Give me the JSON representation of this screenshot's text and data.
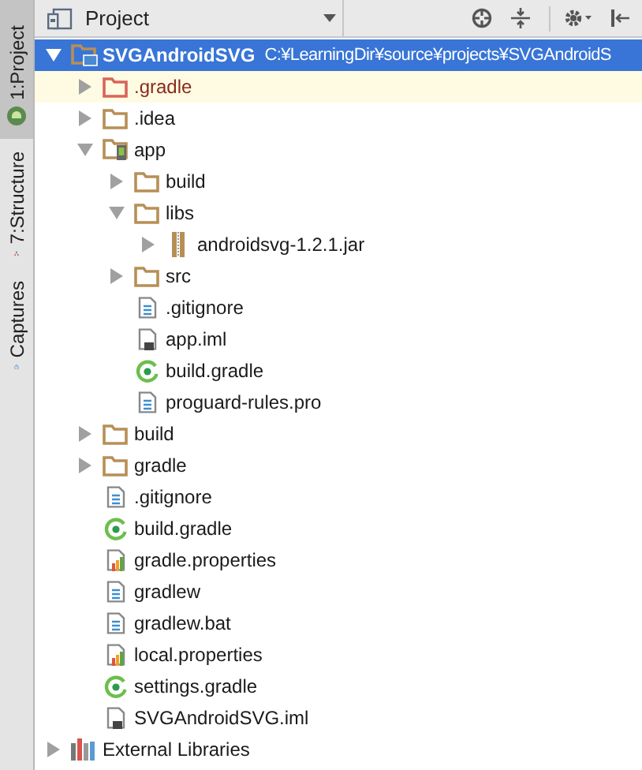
{
  "side_tabs": [
    {
      "label": "1:Project",
      "selected": true
    },
    {
      "label": "7:Structure",
      "selected": false
    },
    {
      "label": "Captures",
      "selected": false
    }
  ],
  "header": {
    "view": "Project"
  },
  "tree": [
    {
      "name": "SVGAndroidSVG",
      "path": "C:¥LearningDir¥source¥projects¥SVGAndroidS",
      "kind": "project",
      "expanded": true,
      "selected": true,
      "highlighted": false,
      "children": [
        {
          "name": ".gradle",
          "kind": "excluded",
          "expanded": false,
          "selected": false,
          "highlighted": true
        },
        {
          "name": ".idea",
          "kind": "folder",
          "expanded": false,
          "selected": false,
          "highlighted": false
        },
        {
          "name": "app",
          "kind": "module",
          "expanded": true,
          "selected": false,
          "highlighted": false,
          "children": [
            {
              "name": "build",
              "kind": "folder",
              "expanded": false,
              "selected": false,
              "highlighted": false
            },
            {
              "name": "libs",
              "kind": "folder",
              "expanded": true,
              "selected": false,
              "highlighted": false,
              "children": [
                {
                  "name": "androidsvg-1.2.1.jar",
                  "kind": "jar",
                  "expanded": false,
                  "selected": false,
                  "highlighted": false
                }
              ]
            },
            {
              "name": "src",
              "kind": "folder",
              "expanded": false,
              "selected": false,
              "highlighted": false
            },
            {
              "name": ".gitignore",
              "kind": "text",
              "selected": false,
              "highlighted": false
            },
            {
              "name": "app.iml",
              "kind": "iml",
              "selected": false,
              "highlighted": false
            },
            {
              "name": "build.gradle",
              "kind": "gradle",
              "selected": false,
              "highlighted": false
            },
            {
              "name": "proguard-rules.pro",
              "kind": "text",
              "selected": false,
              "highlighted": false
            }
          ]
        },
        {
          "name": "build",
          "kind": "folder",
          "expanded": false,
          "selected": false,
          "highlighted": false
        },
        {
          "name": "gradle",
          "kind": "folder",
          "expanded": false,
          "selected": false,
          "highlighted": false
        },
        {
          "name": ".gitignore",
          "kind": "text",
          "selected": false,
          "highlighted": false
        },
        {
          "name": "build.gradle",
          "kind": "gradle",
          "selected": false,
          "highlighted": false
        },
        {
          "name": "gradle.properties",
          "kind": "properties",
          "selected": false,
          "highlighted": false
        },
        {
          "name": "gradlew",
          "kind": "text",
          "selected": false,
          "highlighted": false
        },
        {
          "name": "gradlew.bat",
          "kind": "text",
          "selected": false,
          "highlighted": false
        },
        {
          "name": "local.properties",
          "kind": "properties",
          "selected": false,
          "highlighted": false
        },
        {
          "name": "settings.gradle",
          "kind": "gradle",
          "selected": false,
          "highlighted": false
        },
        {
          "name": "SVGAndroidSVG.iml",
          "kind": "iml",
          "selected": false,
          "highlighted": false
        }
      ]
    },
    {
      "name": "External Libraries",
      "kind": "libraries",
      "expanded": false,
      "selected": false,
      "highlighted": false
    }
  ]
}
